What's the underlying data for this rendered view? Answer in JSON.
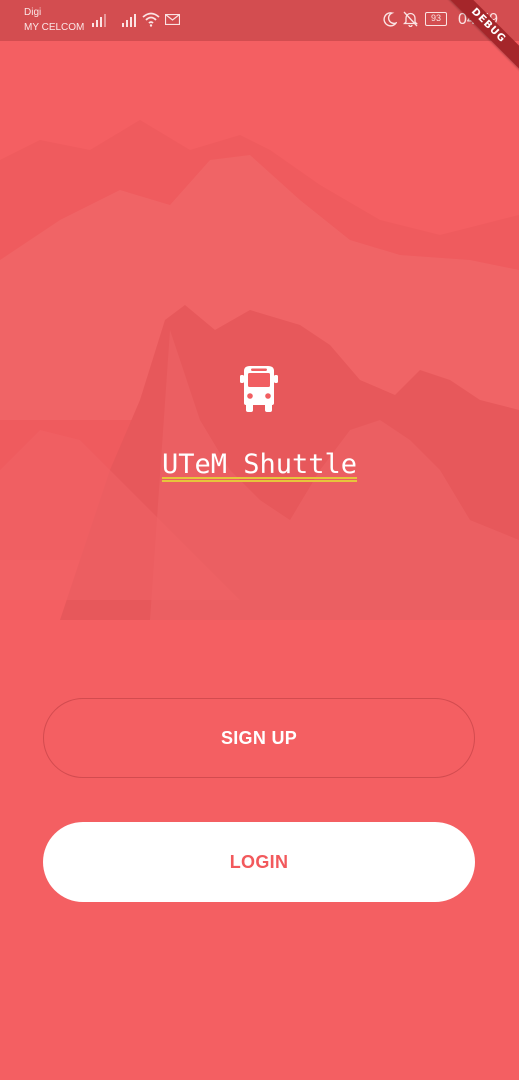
{
  "status_bar": {
    "carrier_1": "Digi",
    "carrier_2": "MY CELCOM",
    "battery": "93",
    "clock": "04:59",
    "icons": [
      "signal-icon",
      "signal-icon",
      "wifi-icon",
      "mail-icon",
      "moon-icon",
      "bell-off-icon",
      "battery-icon"
    ]
  },
  "debug_banner": "DEBUG",
  "logo": {
    "icon": "bus-icon",
    "title": "UTeM Shuttle"
  },
  "actions": {
    "signup_label": "SIGN UP",
    "login_label": "LOGIN"
  },
  "colors": {
    "background": "#f45f62",
    "login_text": "#f2595c",
    "button_fill": "#ffffff",
    "title_underline": "#e7c43c",
    "debug_ribbon": "#a5262a"
  }
}
